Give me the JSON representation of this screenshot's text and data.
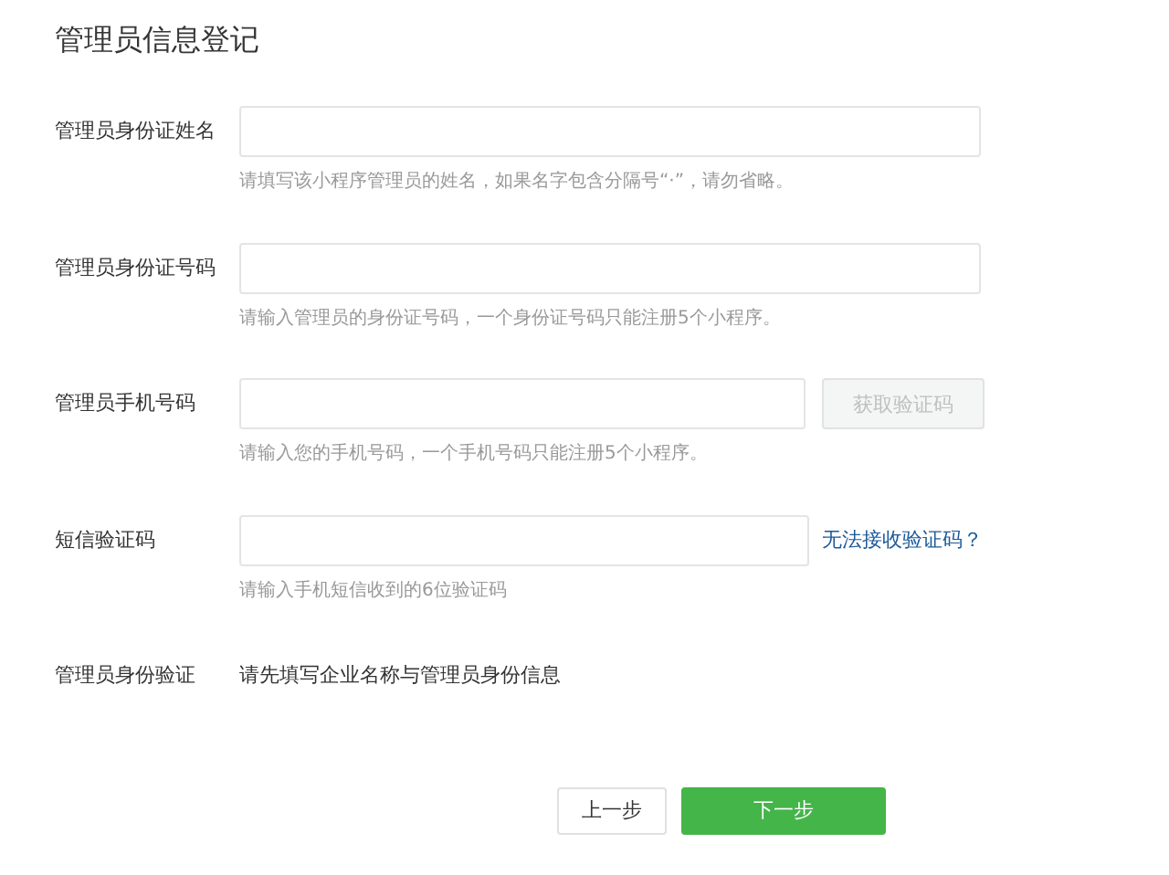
{
  "title": "管理员信息登记",
  "fields": [
    {
      "kind": "input",
      "label": "管理员身份证姓名",
      "hint": "请填写该小程序管理员的姓名，如果名字包含分隔号“·”，请勿省略。"
    },
    {
      "kind": "input",
      "label": "管理员身份证号码",
      "hint": "请输入管理员的身份证号码，一个身份证号码只能注册5个小程序。"
    },
    {
      "kind": "input_button",
      "label": "管理员手机号码",
      "hint": "请输入您的手机号码，一个手机号码只能注册5个小程序。",
      "button": {
        "label": "获取验证码",
        "disabled": true
      }
    },
    {
      "kind": "input_link",
      "label": "短信验证码",
      "hint": "请输入手机短信收到的6位验证码",
      "link": "无法接收验证码？"
    },
    {
      "kind": "text",
      "label": "管理员身份验证",
      "text": "请先填写企业名称与管理员身份信息"
    }
  ],
  "buttons": [
    {
      "label": "上一步",
      "primary": false
    },
    {
      "label": "下一步",
      "primary": true
    }
  ]
}
